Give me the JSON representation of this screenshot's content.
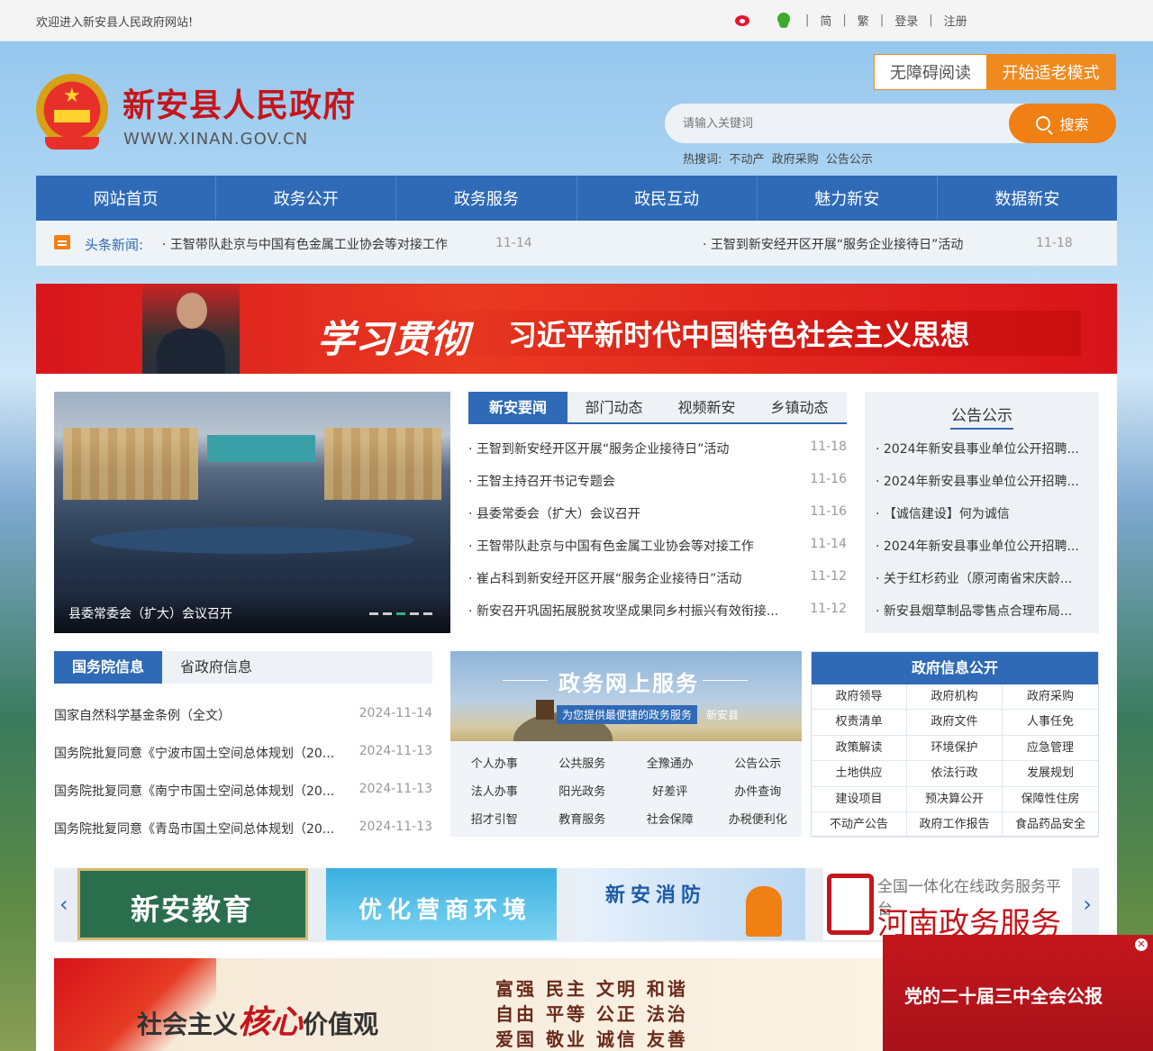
{
  "topbar": {
    "welcome": "欢迎进入新安县人民政府网站!",
    "lang_simplified": "简",
    "lang_traditional": "繁",
    "login": "登录",
    "register": "注册"
  },
  "header": {
    "site_title": "新安县人民政府",
    "site_url": "WWW.XINAN.GOV.CN",
    "accessibility": "无障碍阅读",
    "elder_mode": "开始适老模式",
    "search_placeholder": "请输入关键词",
    "search_button": "搜索",
    "hot_label": "热搜词:",
    "hot_terms": [
      "不动产",
      "政府采购",
      "公告公示"
    ]
  },
  "nav": [
    "网站首页",
    "政务公开",
    "政务服务",
    "政民互动",
    "魅力新安",
    "数据新安"
  ],
  "headline": {
    "label": "头条新闻:",
    "items": [
      {
        "title": "· 王智带队赴京与中国有色金属工业协会等对接工作",
        "date": "11-14"
      },
      {
        "title": "· 王智到新安经开区开展“服务企业接待日”活动",
        "date": "11-18"
      }
    ]
  },
  "banner": {
    "script": "学习贯彻",
    "slogan": "习近平新时代中国特色社会主义思想"
  },
  "photo": {
    "caption": "县委常委会（扩大）会议召开"
  },
  "news_tabs": [
    "新安要闻",
    "部门动态",
    "视频新安",
    "乡镇动态"
  ],
  "news": [
    {
      "title": "· 王智到新安经开区开展“服务企业接待日”活动",
      "date": "11-18"
    },
    {
      "title": "· 王智主持召开书记专题会",
      "date": "11-16"
    },
    {
      "title": "· 县委常委会（扩大）会议召开",
      "date": "11-16"
    },
    {
      "title": "· 王智带队赴京与中国有色金属工业协会等对接工作",
      "date": "11-14"
    },
    {
      "title": "· 崔占科到新安经开区开展“服务企业接待日”活动",
      "date": "11-12"
    },
    {
      "title": "· 新安召开巩固拓展脱贫攻坚成果同乡村振兴有效衔接...",
      "date": "11-12"
    }
  ],
  "notice": {
    "title": "公告公示",
    "items": [
      "· 2024年新安县事业单位公开招聘...",
      "· 2024年新安县事业单位公开招聘...",
      "· 【诚信建设】何为诚信",
      "· 2024年新安县事业单位公开招聘...",
      "· 关于红杉药业（原河南省宋庆龄...",
      "· 新安县烟草制品零售点合理布局..."
    ]
  },
  "state_tabs": [
    "国务院信息",
    "省政府信息"
  ],
  "state_news": [
    {
      "title": "国家自然科学基金条例（全文）",
      "date": "2024-11-14"
    },
    {
      "title": "国务院批复同意《宁波市国土空间总体规划（20...",
      "date": "2024-11-13"
    },
    {
      "title": "国务院批复同意《南宁市国土空间总体规划（20...",
      "date": "2024-11-13"
    },
    {
      "title": "国务院批复同意《青岛市国土空间总体规划（20...",
      "date": "2024-11-13"
    }
  ],
  "services": {
    "title": "政务网上服务",
    "subtitle": "为您提供最便捷的政务服务",
    "county": "新安县",
    "items": [
      "个人办事",
      "公共服务",
      "全豫通办",
      "公告公示",
      "法人办事",
      "阳光政务",
      "好差评",
      "办件查询",
      "招才引智",
      "教育服务",
      "社会保障",
      "办税便利化"
    ]
  },
  "gov_info": {
    "title": "政府信息公开",
    "items": [
      "政府领导",
      "政府机构",
      "政府采购",
      "权责清单",
      "政府文件",
      "人事任免",
      "政策解读",
      "环境保护",
      "应急管理",
      "土地供应",
      "依法行政",
      "发展规划",
      "建设项目",
      "预决算公开",
      "保障性住房",
      "不动产公告",
      "政府工作报告",
      "食品药品安全"
    ]
  },
  "links": {
    "prev": "‹",
    "next": "›",
    "education": "新安教育",
    "business": "优化营商环境",
    "fire": "新安消防",
    "henan_small": "全国一体化在线政务服务平台",
    "henan_big": "河南政务服务网"
  },
  "bottom_banner": {
    "prefix": "社会主义",
    "core": "核心",
    "suffix": "价值观",
    "line1": "富强 民主 文明 和谐",
    "line2": "自由 平等 公正 法治",
    "line3": "爱国 敬业 诚信 友善"
  },
  "popup": {
    "text": "党的二十届三中全会公报"
  }
}
